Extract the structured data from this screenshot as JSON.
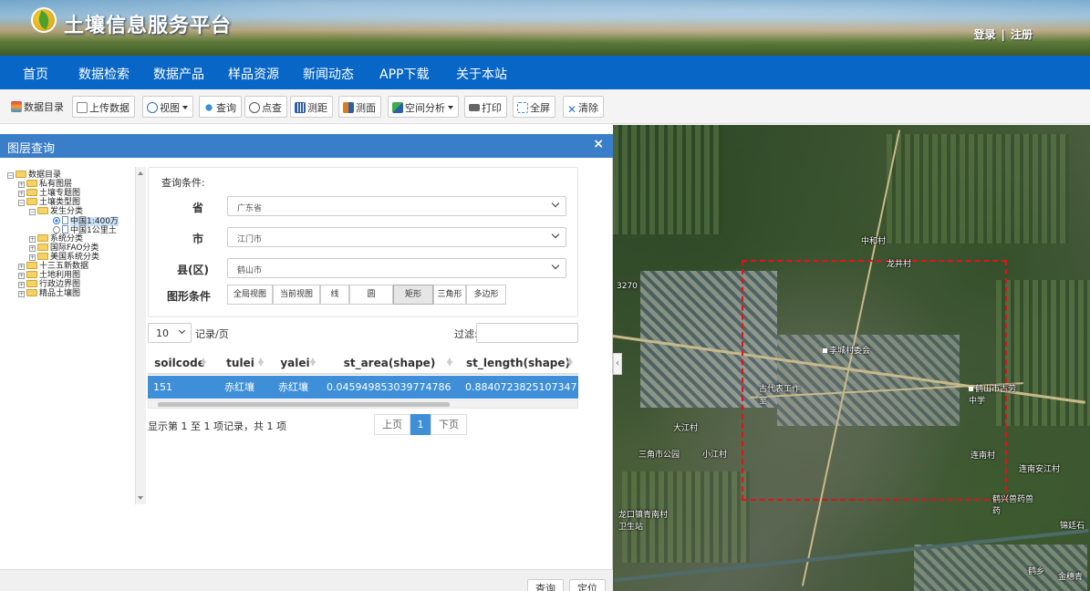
{
  "header": {
    "site_title": "土壤信息服务平台",
    "login": "登录",
    "separator": "|",
    "register": "注册"
  },
  "nav": {
    "items": [
      "首页",
      "数据检索",
      "数据产品",
      "样品资源",
      "新闻动态",
      "APP下载",
      "关于本站"
    ]
  },
  "toolbar": {
    "catalog": "数据目录",
    "upload": "上传数据",
    "view": "视图",
    "query": "查询",
    "point_query": "点查",
    "measure_distance": "测距",
    "measure_area": "测面",
    "spatial_analysis": "空间分析",
    "print": "打印",
    "fullscreen": "全屏",
    "clear": "清除"
  },
  "dialog": {
    "title": "图层查询",
    "close": "×",
    "tree": {
      "root": "数据目录",
      "private": "私有图层",
      "thematic": "土壤专题图",
      "soil_type": "土壤类型图",
      "genetic": "发生分类",
      "leaf1": "中国1:400万",
      "leaf2": "中国1公里土",
      "system": "系统分类",
      "fao": "国际FAO分类",
      "us": "美国系统分类",
      "thirteenth": "十三五新数据",
      "landuse": "土地利用图",
      "admin": "行政边界图",
      "fine": "精品土壤图"
    },
    "query": {
      "condition_label": "查询条件:",
      "province_label": "省",
      "province_value": "广东省",
      "city_label": "市",
      "city_value": "江门市",
      "county_label": "县(区)",
      "county_value": "鹤山市",
      "shape_label": "图形条件",
      "shapes": [
        "全局视图",
        "当前视图",
        "线",
        "圆",
        "矩形",
        "三角形",
        "多边形"
      ],
      "active_shape": "矩形"
    },
    "table": {
      "page_size": "10",
      "page_size_label": "记录/页",
      "filter_label": "过滤:",
      "columns": [
        "soilcode",
        "tulei",
        "yalei",
        "st_area(shape)",
        "st_length(shape)"
      ],
      "rows": [
        [
          "151",
          "赤红壤",
          "赤红壤",
          "0.045949853039774786",
          "0.8840723825107347"
        ]
      ],
      "info": "显示第 1 至 1 项记录，共 1 项",
      "prev": "上页",
      "current_page": "1",
      "next": "下页"
    },
    "footer": {
      "query": "查询",
      "locate": "定位"
    }
  },
  "map": {
    "labels": [
      "中和村",
      "龙井村",
      "李城村委会",
      "古代表工作室",
      "鹤山市古劳中学",
      "大江村",
      "三角市公园",
      "小江村",
      "连南村",
      "连南安江村",
      "鹤兴兽药兽药",
      "龙口镇青南村卫生站",
      "锦廷石",
      "鹤乡",
      "金穗青",
      "3270"
    ],
    "collapse_arrow": "‹"
  },
  "colors": {
    "nav_bg": "#0866c6",
    "dialog_header": "#3a7dc8",
    "selected_row": "#3e8fd8",
    "selection_rect": "#e0121c"
  }
}
